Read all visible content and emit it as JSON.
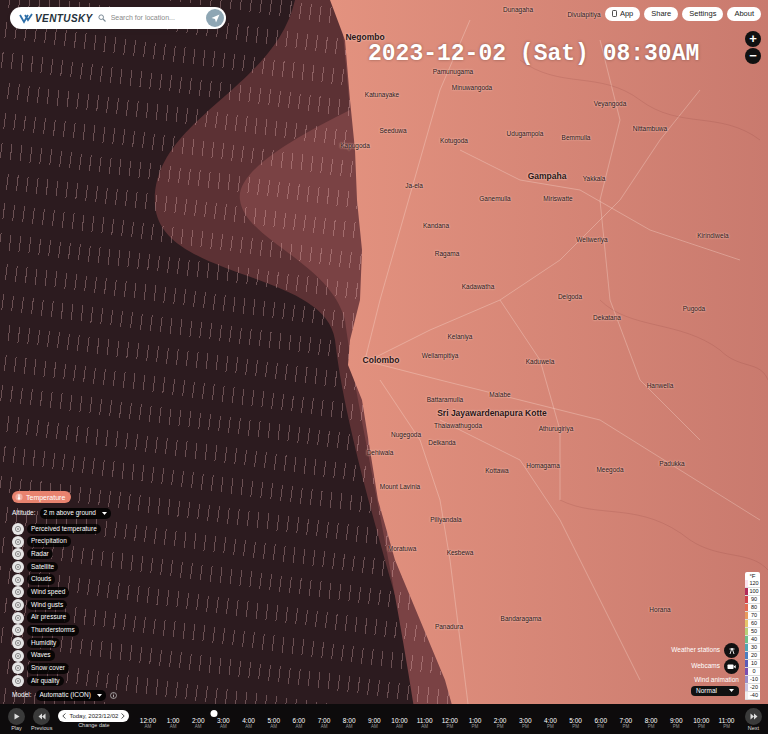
{
  "brand": {
    "logo": "VENTUSKY"
  },
  "search": {
    "placeholder": "Search for location..."
  },
  "top_buttons": [
    {
      "label": "App"
    },
    {
      "label": "Share"
    },
    {
      "label": "Settings"
    },
    {
      "label": "About"
    }
  ],
  "zoom": [
    "+",
    "−"
  ],
  "datetime": "2023-12-02 (Sat) 08:30AM",
  "map": {
    "labels": [
      {
        "text": "Negombo",
        "major": true
      },
      {
        "text": "Dunagaha",
        "major": false
      },
      {
        "text": "Divulapitiya",
        "major": false
      },
      {
        "text": "Pamunugama",
        "major": false
      },
      {
        "text": "Minuwangoda",
        "major": false
      },
      {
        "text": "Katunayake",
        "major": false
      },
      {
        "text": "Veyangoda",
        "major": false
      },
      {
        "text": "Nittambuwa",
        "major": false
      },
      {
        "text": "Seeduwa",
        "major": false
      },
      {
        "text": "Udugampola",
        "major": false
      },
      {
        "text": "Bemmulla",
        "major": false
      },
      {
        "text": "Kotugoda",
        "major": false
      },
      {
        "text": "Kapugoda",
        "major": false
      },
      {
        "text": "Gampaha",
        "major": true
      },
      {
        "text": "Yakkala",
        "major": false
      },
      {
        "text": "Ja-ela",
        "major": false
      },
      {
        "text": "Ganemulla",
        "major": false
      },
      {
        "text": "Miriswatte",
        "major": false
      },
      {
        "text": "Kandana",
        "major": false
      },
      {
        "text": "Weliweriya",
        "major": false
      },
      {
        "text": "Kirindiwela",
        "major": false
      },
      {
        "text": "Ragama",
        "major": false
      },
      {
        "text": "Kadawatha",
        "major": false
      },
      {
        "text": "Delgoda",
        "major": false
      },
      {
        "text": "Pugoda",
        "major": false
      },
      {
        "text": "Dekatana",
        "major": false
      },
      {
        "text": "Kelaniya",
        "major": false
      },
      {
        "text": "Colombo",
        "major": true
      },
      {
        "text": "Wellampitiya",
        "major": false
      },
      {
        "text": "Kaduwela",
        "major": false
      },
      {
        "text": "Hanwella",
        "major": false
      },
      {
        "text": "Malabe",
        "major": false
      },
      {
        "text": "Battaramulla",
        "major": false
      },
      {
        "text": "Sri Jayawardenapura Kotte",
        "major": true
      },
      {
        "text": "Thalawathugoda",
        "major": false
      },
      {
        "text": "Athurugiriya",
        "major": false
      },
      {
        "text": "Nugegoda",
        "major": false
      },
      {
        "text": "Delkanda",
        "major": false
      },
      {
        "text": "Dehiwala",
        "major": false
      },
      {
        "text": "Meegoda",
        "major": false
      },
      {
        "text": "Padukka",
        "major": false
      },
      {
        "text": "Homagama",
        "major": false
      },
      {
        "text": "Kottawa",
        "major": false
      },
      {
        "text": "Mount Lavinia",
        "major": false
      },
      {
        "text": "Piliyandala",
        "major": false
      },
      {
        "text": "Moratuwa",
        "major": false
      },
      {
        "text": "Kesbewa",
        "major": false
      },
      {
        "text": "Horana",
        "major": false
      },
      {
        "text": "Bandaragama",
        "major": false
      },
      {
        "text": "Panadura",
        "major": false
      }
    ]
  },
  "layers": {
    "active": {
      "label": "Temperature",
      "selected": true
    },
    "altitude": {
      "label": "Altitude:",
      "value": "2 m above ground"
    },
    "items": [
      {
        "label": "Perceived temperature",
        "selected": false
      },
      {
        "label": "Precipitation",
        "selected": false
      },
      {
        "label": "Radar",
        "selected": false
      },
      {
        "label": "Satellite",
        "selected": false
      },
      {
        "label": "Clouds",
        "selected": false
      },
      {
        "label": "Wind speed",
        "selected": false
      },
      {
        "label": "Wind gusts",
        "selected": false
      },
      {
        "label": "Air pressure",
        "selected": false
      },
      {
        "label": "Thunderstorms",
        "selected": false
      },
      {
        "label": "Humidity",
        "selected": false
      },
      {
        "label": "Waves",
        "selected": false
      },
      {
        "label": "Snow cover",
        "selected": false
      },
      {
        "label": "Air quality",
        "selected": false
      }
    ],
    "model": {
      "label": "Model:",
      "value": "Automatic (ICON)"
    }
  },
  "legend": {
    "unit": "°F",
    "ticks": [
      {
        "value": "120",
        "color": "#fbe3ef"
      },
      {
        "value": "100",
        "color": "#b02a5a"
      },
      {
        "value": "90",
        "color": "#d0404a"
      },
      {
        "value": "80",
        "color": "#e56a50"
      },
      {
        "value": "70",
        "color": "#e89a5c"
      },
      {
        "value": "60",
        "color": "#e6c56a"
      },
      {
        "value": "50",
        "color": "#b8d07a"
      },
      {
        "value": "40",
        "color": "#6fbf8a"
      },
      {
        "value": "30",
        "color": "#4ea6b5"
      },
      {
        "value": "20",
        "color": "#4b7fc0"
      },
      {
        "value": "10",
        "color": "#5b5cb8"
      },
      {
        "value": "0",
        "color": "#7a4fb0"
      },
      {
        "value": "-10",
        "color": "#9b8ec8"
      },
      {
        "value": "-20",
        "color": "#c9c3e0"
      },
      {
        "value": "-40",
        "color": "#eeeeee"
      }
    ]
  },
  "toggles": [
    {
      "label": "Weather stations",
      "on": false
    },
    {
      "label": "Webcams",
      "on": false
    }
  ],
  "wind_animation": {
    "label": "Wind animation",
    "value": "Normal"
  },
  "timeline": {
    "play": "Play",
    "previous": "Previous",
    "date": "Today, 2023/12/02",
    "change_date": "Change date",
    "next": "Next",
    "level": 0.13,
    "hours": [
      {
        "time": "12:00",
        "period": "AM"
      },
      {
        "time": "1:00",
        "period": "AM"
      },
      {
        "time": "2:00",
        "period": "AM"
      },
      {
        "time": "3:00",
        "period": "AM"
      },
      {
        "time": "4:00",
        "period": "AM"
      },
      {
        "time": "5:00",
        "period": "AM"
      },
      {
        "time": "6:00",
        "period": "AM"
      },
      {
        "time": "7:00",
        "period": "AM"
      },
      {
        "time": "8:00",
        "period": "AM"
      },
      {
        "time": "9:00",
        "period": "AM"
      },
      {
        "time": "10:00",
        "period": "AM"
      },
      {
        "time": "11:00",
        "period": "AM"
      },
      {
        "time": "12:00",
        "period": "PM"
      },
      {
        "time": "1:00",
        "period": "PM"
      },
      {
        "time": "2:00",
        "period": "PM"
      },
      {
        "time": "3:00",
        "period": "PM"
      },
      {
        "time": "4:00",
        "period": "PM"
      },
      {
        "time": "5:00",
        "period": "PM"
      },
      {
        "time": "6:00",
        "period": "PM"
      },
      {
        "time": "7:00",
        "period": "PM"
      },
      {
        "time": "8:00",
        "period": "PM"
      },
      {
        "time": "9:00",
        "period": "PM"
      },
      {
        "time": "10:00",
        "period": "PM"
      },
      {
        "time": "11:00",
        "period": "PM"
      }
    ]
  }
}
